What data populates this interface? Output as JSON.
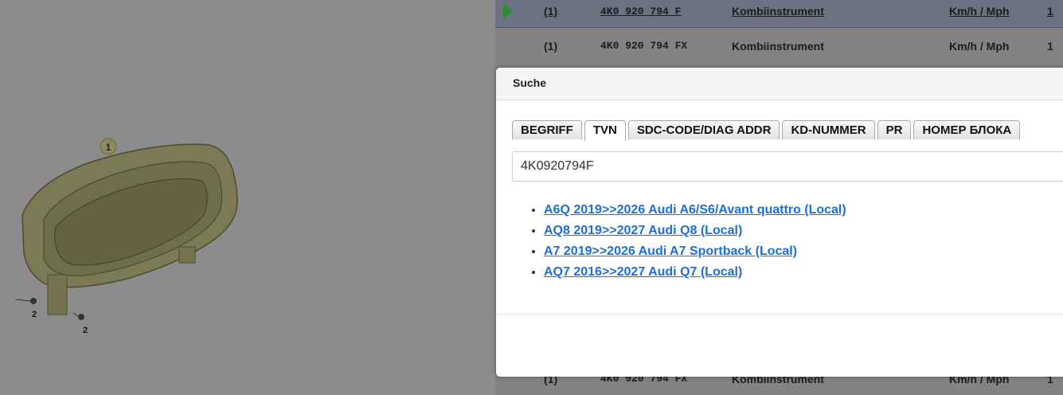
{
  "diagram": {
    "callouts": [
      "1",
      "2",
      "2"
    ]
  },
  "parts_table": {
    "rows": [
      {
        "pos": "(1)",
        "part_number": "4K0 920 794 F",
        "name": "Kombiinstrument",
        "unit": "Km/h / Mph",
        "qty": "1",
        "selected": true
      },
      {
        "pos": "(1)",
        "part_number": "4K0 920 794 FX",
        "name": "Kombiinstrument",
        "unit": "Km/h / Mph",
        "qty": "1",
        "selected": false
      },
      {
        "pos": "(1)",
        "part_number": "4K0 920 794 FX",
        "name": "Kombiinstrument",
        "unit": "Km/h / Mph",
        "qty": "1",
        "selected": false
      }
    ]
  },
  "modal": {
    "title": "Suche",
    "tabs": [
      "BEGRIFF",
      "TVN",
      "SDC-CODE/DIAG ADDR",
      "KD-NUMMER",
      "PR",
      "НОМЕР БЛОКА"
    ],
    "active_tab": "TVN",
    "search_value": "4K0920794F",
    "results": [
      "A6Q 2019>>2026 Audi A6/S6/Avant quattro (Local)",
      "AQ8 2019>>2027 Audi Q8 (Local)",
      "A7 2019>>2026 Audi A7 Sportback (Local)",
      "AQ7 2016>>2027 Audi Q7 (Local)"
    ]
  },
  "colors": {
    "overlay_bg": "#8c8c8c",
    "selected_row": "#6b7382",
    "link": "#1a6fd8",
    "play_icon": "#2e8b2e"
  },
  "icons": {
    "row_marker": "play-icon"
  }
}
